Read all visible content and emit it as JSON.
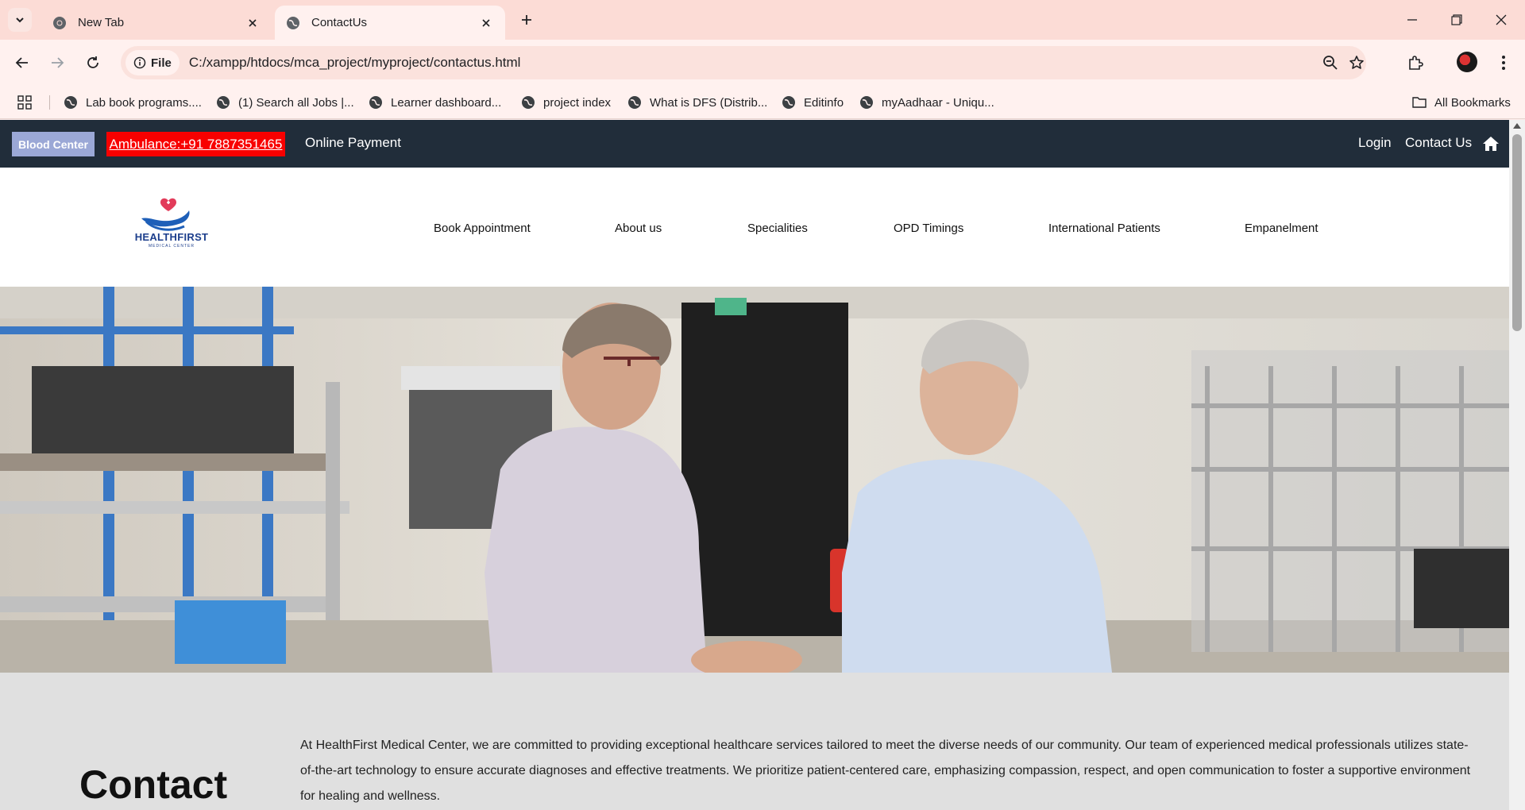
{
  "browser": {
    "tabs": [
      {
        "title": "New Tab",
        "active": false
      },
      {
        "title": "ContactUs",
        "active": true
      }
    ],
    "site_chip": "File",
    "url": "C:/xampp/htdocs/mca_project/myproject/contactus.html",
    "bookmarks": [
      "Lab book programs....",
      "(1) Search all Jobs |...",
      "Learner dashboard...",
      "project index",
      "What is DFS (Distrib...",
      "Editinfo",
      "myAadhaar - Uniqu..."
    ],
    "all_bookmarks": "All Bookmarks"
  },
  "topbar": {
    "blood_center": "Blood Center",
    "ambulance": "Ambulance:+91 7887351465",
    "online_payment": "Online Payment",
    "login": "Login",
    "contact_us": "Contact Us"
  },
  "logo": {
    "name": "HEALTHFIRST",
    "subtitle": "MEDICAL CENTER"
  },
  "menu": [
    "Book Appointment",
    "About us",
    "Specialities",
    "OPD Timings",
    "International Patients",
    "Empanelment"
  ],
  "about": {
    "title": "Contact",
    "text": "At HealthFirst Medical Center, we are committed to providing exceptional healthcare services tailored to meet the diverse needs of our community. Our team of experienced medical professionals utilizes state-of-the-art technology to ensure accurate diagnoses and effective treatments. We prioritize patient-centered care, emphasizing compassion, respect, and open communication to foster a supportive environment for healing and wellness."
  },
  "colors": {
    "tabbar": "#fcdcd6",
    "topstrip": "#212d3a",
    "blood_btn": "#9ba8d6",
    "ambulance_btn": "#f80000",
    "about_bg": "#e0e0e0"
  }
}
